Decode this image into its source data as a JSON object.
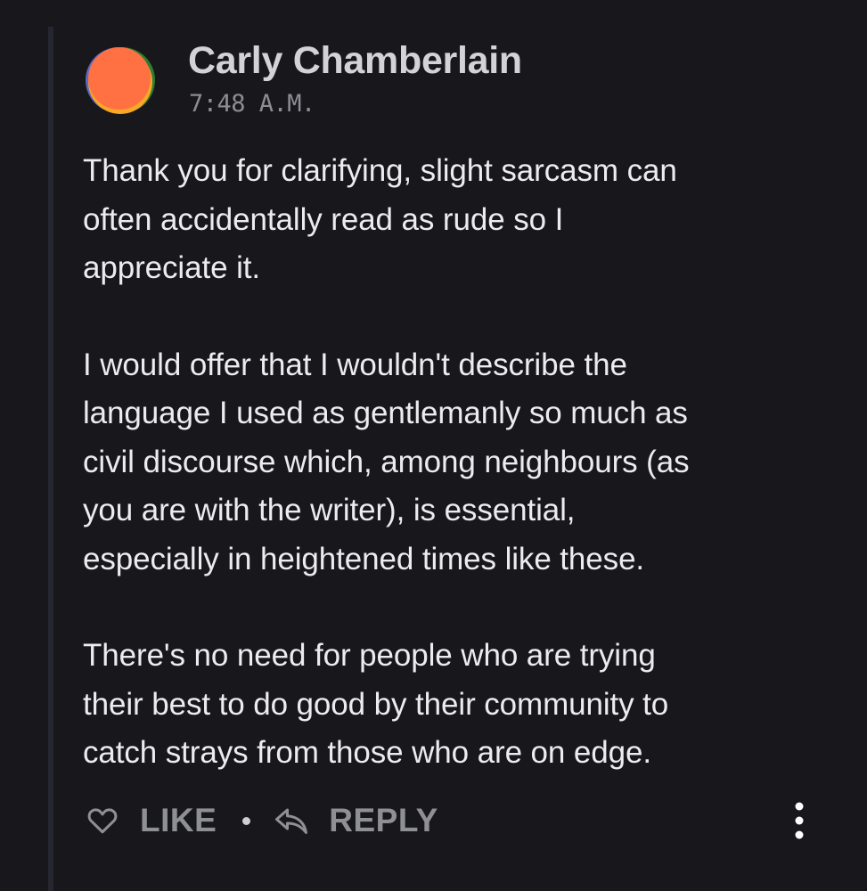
{
  "comment": {
    "author": "Carly Chamberlain",
    "timestamp": "7:48 A.M.",
    "paragraphs": [
      "Thank you for clarifying, slight sarcasm can\noften accidentally read as rude so I\nappreciate it.",
      "I would offer that I wouldn't describe the\nlanguage I used as gentlemanly so much as\ncivil discourse which, among neighbours (as\nyou are with the writer), is essential,\nespecially in heightened times like these.",
      "There's no need for people who are trying\ntheir best to do good by their community to\ncatch strays from those who are on edge."
    ],
    "avatar_colors": [
      "#ff7043",
      "#f9a825",
      "#2e7d32",
      "#5c6bc0"
    ]
  },
  "actions": {
    "like_label": "LIKE",
    "reply_label": "REPLY",
    "icons": [
      "heart-icon",
      "reply-arrow-icon",
      "more-vertical-icon"
    ]
  }
}
